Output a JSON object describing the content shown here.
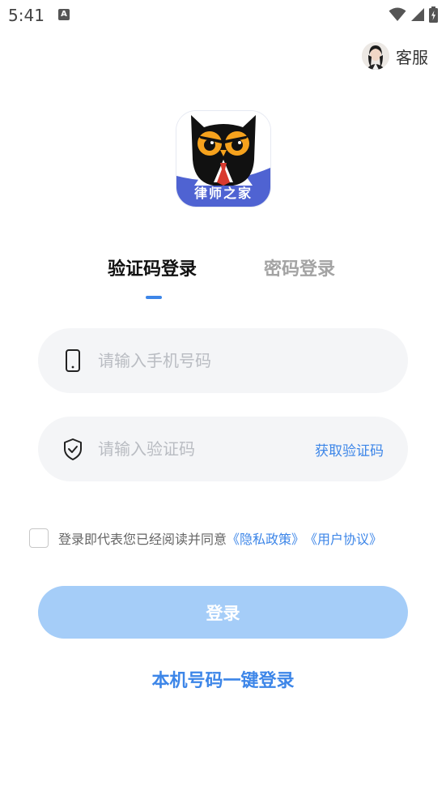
{
  "status_bar": {
    "time": "5:41",
    "a_badge": "A"
  },
  "header": {
    "service_label": "客服"
  },
  "logo": {
    "app_name": "律师之家"
  },
  "tabs": [
    {
      "label": "验证码登录",
      "active": true
    },
    {
      "label": "密码登录",
      "active": false
    }
  ],
  "form": {
    "phone_placeholder": "请输入手机号码",
    "code_placeholder": "请输入验证码",
    "get_code_label": "获取验证码"
  },
  "agreement": {
    "text": "登录即代表您已经阅读并同意",
    "privacy_link": "《隐私政策》",
    "user_link": "《用户协议》",
    "checked": false
  },
  "buttons": {
    "login_label": "登录",
    "one_click_label": "本机号码一键登录"
  },
  "colors": {
    "accent": "#3d86e8",
    "login_disabled": "#a5cdf8",
    "field_bg": "#f4f5f7",
    "logo_band": "#4f63d2"
  }
}
